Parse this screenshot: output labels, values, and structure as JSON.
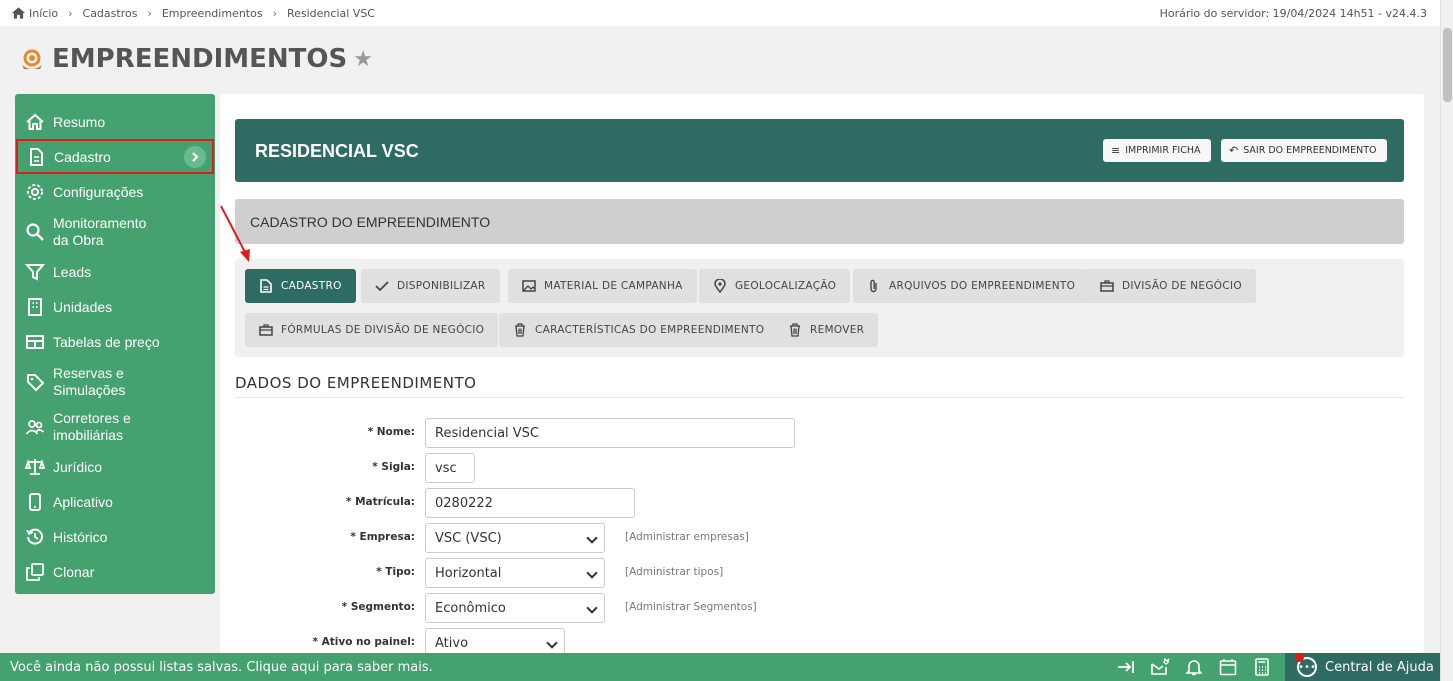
{
  "breadcrumb": [
    "Início",
    "Cadastros",
    "Empreendimentos",
    "Residencial VSC"
  ],
  "server_info": "Horário do servidor: 19/04/2024 14h51 - v24.4.3",
  "page": {
    "title": "EMPREENDIMENTOS"
  },
  "sidebar": {
    "items": [
      {
        "label": "Resumo",
        "icon": "home-icon"
      },
      {
        "label": "Cadastro",
        "icon": "document-icon",
        "active": true
      },
      {
        "label": "Configurações",
        "icon": "gear-icon"
      },
      {
        "label": "Monitoramento da Obra",
        "line1": "Monitoramento",
        "line2": "da Obra",
        "icon": "search-icon"
      },
      {
        "label": "Leads",
        "icon": "filter-icon"
      },
      {
        "label": "Unidades",
        "icon": "building-icon"
      },
      {
        "label": "Tabelas de preço",
        "icon": "table-icon"
      },
      {
        "label": "Reservas e Simulações",
        "line1": "Reservas e",
        "line2": "Simulações",
        "icon": "tag-icon"
      },
      {
        "label": "Corretores e imobiliárias",
        "line1": "Corretores e",
        "line2": "imobiliárias",
        "icon": "users-icon"
      },
      {
        "label": "Jurídico",
        "icon": "scales-icon"
      },
      {
        "label": "Aplicativo",
        "icon": "phone-icon"
      },
      {
        "label": "Histórico",
        "icon": "history-icon"
      },
      {
        "label": "Clonar",
        "icon": "copy-icon"
      }
    ]
  },
  "hero": {
    "name": "RESIDENCIAL VSC",
    "print_label": "IMPRIMIR FICHA",
    "exit_label": "SAIR DO EMPREENDIMENTO"
  },
  "section_title": "CADASTRO DO EMPREENDIMENTO",
  "tabs": [
    {
      "label": "CADASTRO",
      "icon": "document-icon",
      "active": true
    },
    {
      "label": "DISPONIBILIZAR",
      "icon": "check-icon"
    },
    {
      "label": "MATERIAL DE CAMPANHA",
      "icon": "image-icon"
    },
    {
      "label": "GEOLOCALIZAÇÃO",
      "icon": "pin-icon"
    },
    {
      "label": "ARQUIVOS DO EMPREENDIMENTO",
      "icon": "paperclip-icon"
    },
    {
      "label": "DIVISÃO DE NEGÓCIO",
      "icon": "briefcase-icon"
    },
    {
      "label": "FÓRMULAS DE DIVISÃO DE NEGÓCIO",
      "icon": "briefcase-icon"
    },
    {
      "label": "CARACTERÍSTICAS DO EMPREENDIMENTO",
      "icon": "trash-icon"
    },
    {
      "label": "REMOVER",
      "icon": "trash-icon"
    }
  ],
  "form": {
    "title": "DADOS DO EMPREENDIMENTO",
    "fields": [
      {
        "label": "* Nome:",
        "value": "Residencial VSC"
      },
      {
        "label": "* Sigla:",
        "value": "vsc"
      },
      {
        "label": "* Matrícula:",
        "value": "0280222"
      },
      {
        "label": "* Empresa:",
        "value": "VSC (VSC)",
        "admin": "[Administrar empresas]"
      },
      {
        "label": "* Tipo:",
        "value": "Horizontal",
        "admin": "[Administrar tipos]"
      },
      {
        "label": "* Segmento:",
        "value": "Econômico",
        "admin": "[Administrar Segmentos]"
      },
      {
        "label": "* Ativo no painel:",
        "value": "Ativo"
      }
    ]
  },
  "bottom": {
    "message": "Você ainda não possui listas salvas. Clique aqui para saber mais.",
    "help_label": "Central de Ajuda"
  },
  "colors": {
    "sidebar": "#45a16f",
    "hero": "#2d6b63",
    "highlight": "#e01b1b"
  }
}
